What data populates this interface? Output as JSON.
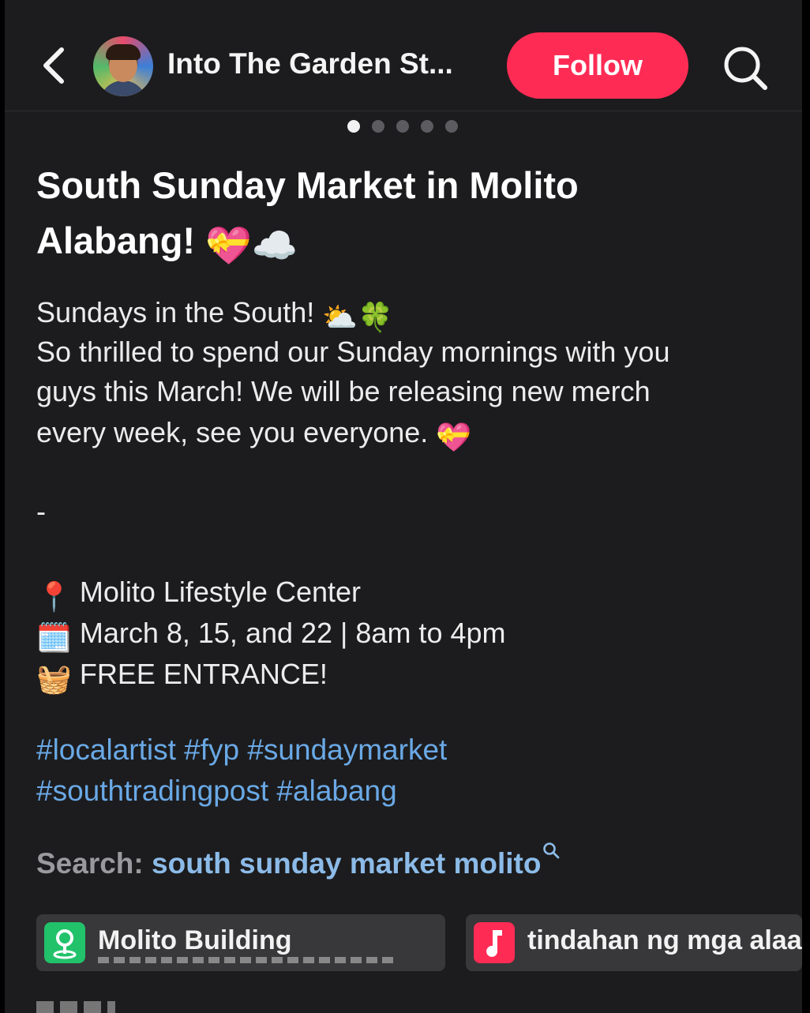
{
  "header": {
    "account_name": "Into The Garden St...",
    "follow_label": "Follow"
  },
  "post": {
    "title_line1": "South Sunday Market in Molito",
    "title_line2": "Alabang!",
    "title_emojis": "💝☁️",
    "intro_line": "Sundays in the South!",
    "intro_emojis": "⛅🍀",
    "body_line1": "So thrilled to spend our Sunday mornings with you",
    "body_line2": "guys this March! We will be releasing new merch",
    "body_line3": "every week, see you everyone.",
    "body_emoji": "💝",
    "separator": "-",
    "location_icon": "📍",
    "location": "Molito Lifestyle Center",
    "calendar_icon": "🗓️",
    "dates": "March 8, 15, and 22 | 8am to 4pm",
    "basket_icon": "🧺",
    "entrance": "FREE ENTRANCE!",
    "hashtags_line1": "#localartist #fyp #sundaymarket",
    "hashtags_line2": "#southtradingpost #alabang",
    "search_prefix": "Search:",
    "search_term": "south sunday market molito"
  },
  "chips": [
    {
      "label": "Molito Building",
      "icon": "location-pin-icon",
      "color": "#22c26b"
    },
    {
      "label": "tindahan ng mga alaala",
      "icon": "music-note-icon",
      "color": "#fe2c55"
    }
  ],
  "colors": {
    "background": "#1c1c1e",
    "accent": "#fe2c55",
    "hashtag": "#6aa9e6"
  }
}
